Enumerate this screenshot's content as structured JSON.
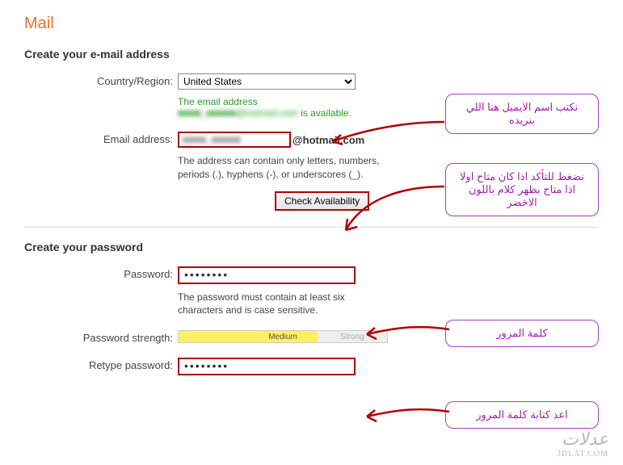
{
  "header": {
    "title": "Mail"
  },
  "section_email": {
    "title": "Create your e-mail address",
    "country_label": "Country/Region:",
    "country_value": "United States",
    "avail_prefix": "The email address",
    "avail_blurred": "■■■■_■■■■■@hotmail.com",
    "avail_suffix": "is available.",
    "email_label": "Email address:",
    "email_blurred": "■■■■_■■■■■",
    "email_suffix": "@hotmail.com",
    "hint": "The address can contain only letters, numbers, periods (.), hyphens (-), or underscores (_).",
    "check_button": "Check Availability"
  },
  "section_password": {
    "title": "Create your password",
    "password_label": "Password:",
    "password_value": "••••••••",
    "hint": "The password must contain at least six characters and is case sensitive.",
    "strength_label": "Password strength:",
    "strength_medium": "Medium",
    "strength_strong": "Strong",
    "retype_label": "Retype password:",
    "retype_value": "••••••••"
  },
  "callouts": {
    "c1": "نكتب اسم الايميل هنا اللي بنريده",
    "c2": "نضغط للتأكد اذا كان متاح اولا اذا متاح بظهر كلام باللون الاخضر",
    "c3": "كلمة المرور",
    "c4": "اعد كتابة كلمة المرور"
  },
  "watermark": {
    "name": "عدلات",
    "url": "3DLAT.COM"
  }
}
